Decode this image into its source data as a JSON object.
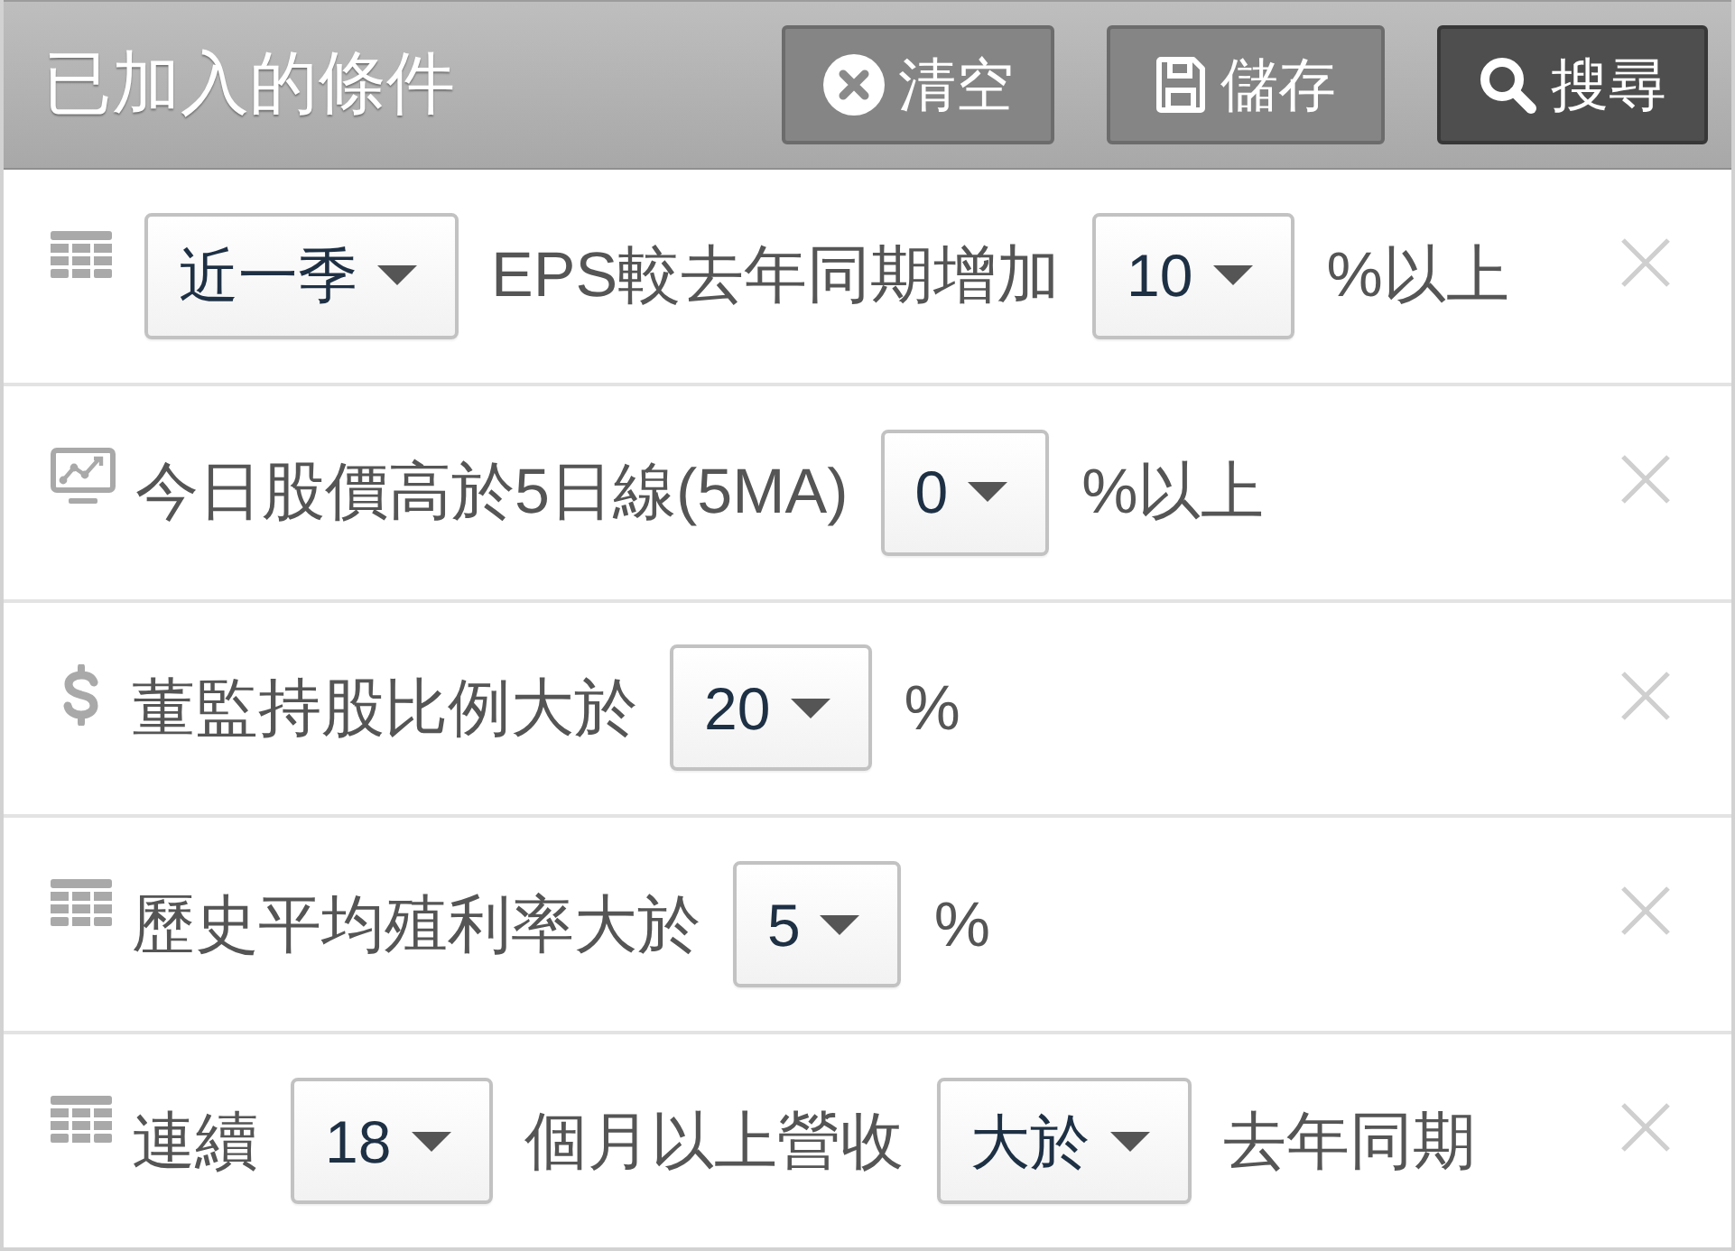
{
  "panel": {
    "title": "已加入的條件",
    "buttons": [
      {
        "kind": "clear",
        "label": "清空"
      },
      {
        "kind": "save",
        "label": "儲存"
      },
      {
        "kind": "search",
        "label": "搜尋"
      }
    ]
  },
  "conditions": [
    {
      "kind": "table",
      "parts": [
        {
          "kind": "select",
          "value": "近一季"
        },
        {
          "kind": "text",
          "text": "EPS較去年同期增加"
        },
        {
          "kind": "select",
          "value": "10"
        },
        {
          "kind": "text",
          "text": "%以上"
        }
      ]
    },
    {
      "kind": "chart",
      "parts": [
        {
          "kind": "text",
          "text": "今日股價高於5日線(5MA)"
        },
        {
          "kind": "select",
          "value": "0"
        },
        {
          "kind": "text",
          "text": "%以上"
        }
      ]
    },
    {
      "kind": "dollar",
      "parts": [
        {
          "kind": "text",
          "text": "董監持股比例大於"
        },
        {
          "kind": "select",
          "value": "20"
        },
        {
          "kind": "text",
          "text": "%"
        }
      ]
    },
    {
      "kind": "table",
      "parts": [
        {
          "kind": "text",
          "text": "歷史平均殖利率大於"
        },
        {
          "kind": "select",
          "value": "5"
        },
        {
          "kind": "text",
          "text": "%"
        }
      ]
    },
    {
      "kind": "table",
      "parts": [
        {
          "kind": "text",
          "text": "連續"
        },
        {
          "kind": "select",
          "value": "18"
        },
        {
          "kind": "text",
          "text": "個月以上營收"
        },
        {
          "kind": "select",
          "value": "大於"
        },
        {
          "kind": "text",
          "text": "去年同期"
        }
      ]
    }
  ]
}
